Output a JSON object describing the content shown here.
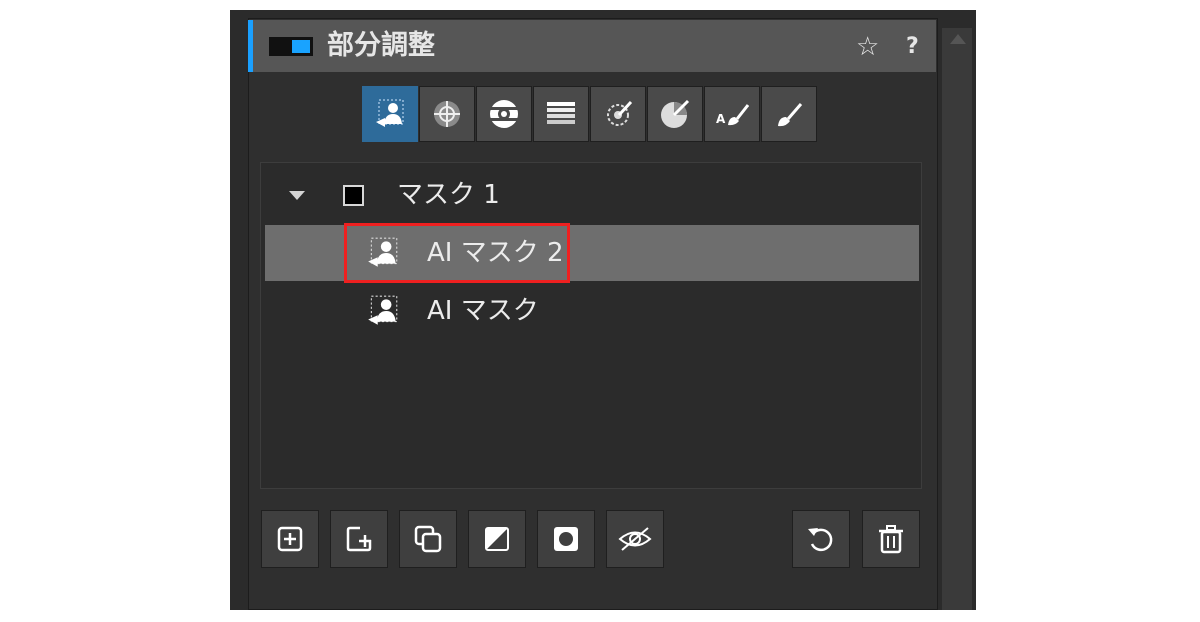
{
  "panel": {
    "title": "部分調整",
    "star_icon": "star-icon",
    "help_label": "?"
  },
  "toolbar": {
    "tools": [
      {
        "name": "ai-mask-tool-icon",
        "active": true
      },
      {
        "name": "control-point-tool-icon",
        "active": false
      },
      {
        "name": "radial-filter-tool-icon",
        "active": false
      },
      {
        "name": "linear-gradient-tool-icon",
        "active": false
      },
      {
        "name": "color-range-tool-icon",
        "active": false
      },
      {
        "name": "luminosity-range-tool-icon",
        "active": false
      },
      {
        "name": "auto-brush-tool-icon",
        "active": false
      },
      {
        "name": "brush-tool-icon",
        "active": false
      }
    ]
  },
  "mask_list": {
    "group_label": "マスク 1",
    "items": [
      {
        "label": "AI マスク 2",
        "selected": true,
        "highlighted": true
      },
      {
        "label": "AI マスク",
        "selected": false,
        "highlighted": false
      }
    ]
  },
  "bottom_buttons": [
    "add-mask-icon",
    "add-to-mask-icon",
    "duplicate-icon",
    "invert-icon",
    "mask-overlay-icon",
    "hide-mask-icon",
    "reset-icon",
    "delete-icon"
  ],
  "colors": {
    "accent": "#1aa0ff",
    "highlight_box": "#ef2020",
    "active_tool": "#2e6b9a",
    "selected_row": "#6e6e6e"
  }
}
